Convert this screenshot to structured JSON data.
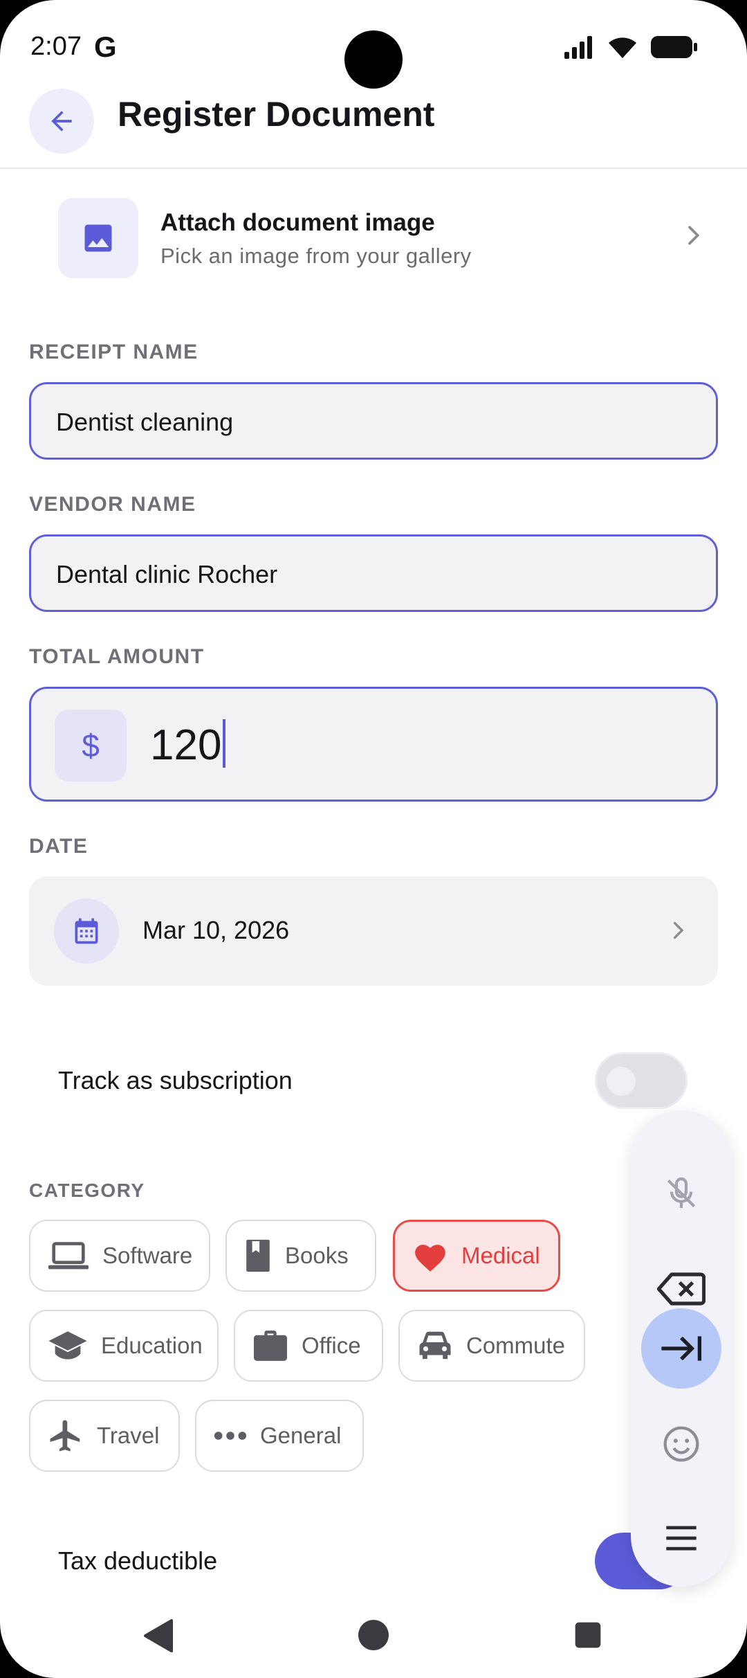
{
  "status": {
    "time": "2:07",
    "g_label": "G"
  },
  "appbar": {
    "title": "Register Document"
  },
  "attach": {
    "title": "Attach document image",
    "subtitle": "Pick an image from your gallery"
  },
  "receipt": {
    "label": "RECEIPT NAME",
    "value": "Dentist cleaning"
  },
  "vendor": {
    "label": "VENDOR NAME",
    "value": "Dental clinic Rocher"
  },
  "amount": {
    "label": "TOTAL AMOUNT",
    "currency": "$",
    "value": "120"
  },
  "date": {
    "label": "DATE",
    "value": "Mar 10, 2026"
  },
  "subscription": {
    "label": "Track as subscription",
    "on": false
  },
  "category": {
    "label": "CATEGORY",
    "selected": "Medical",
    "chips": [
      {
        "label": "Software",
        "icon": "laptop-icon"
      },
      {
        "label": "Books",
        "icon": "book-icon"
      },
      {
        "label": "Medical",
        "icon": "heart-icon"
      },
      {
        "label": "Education",
        "icon": "graduation-cap-icon"
      },
      {
        "label": "Office",
        "icon": "briefcase-icon"
      },
      {
        "label": "Commute",
        "icon": "car-icon"
      },
      {
        "label": "Travel",
        "icon": "airplane-icon"
      },
      {
        "label": "General",
        "icon": "more-horizontal-icon"
      }
    ]
  },
  "tax": {
    "label": "Tax deductible",
    "on": true
  },
  "keyboard_toolbar": {
    "buttons": [
      "mic-off-icon",
      "backspace-icon",
      "tab-arrow-icon",
      "emoji-icon",
      "menu-icon"
    ]
  },
  "colors": {
    "accent": "#5b5bd8",
    "selected_chip": "#e94b4b",
    "surface": "#f2f2f4"
  }
}
